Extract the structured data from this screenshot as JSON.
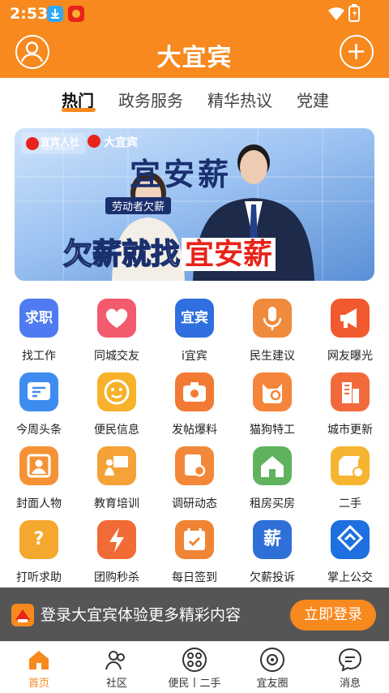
{
  "status_bar": {
    "time": "2:53"
  },
  "header": {
    "title": "大宜宾"
  },
  "tabs": [
    "热门",
    "政务服务",
    "精华热议",
    "党建"
  ],
  "banner": {
    "logo_left": "宜宾人社",
    "logo_left_sub": "YIBIN RENSHE",
    "logo_right": "大宜宾",
    "brand": "宜安薪",
    "subtitle": "劳动者欠薪",
    "headline_a": "欠薪就找",
    "headline_b": "宜安薪"
  },
  "grid": [
    {
      "label": "找工作",
      "icon": "job-icon",
      "color": "#4F7BF2",
      "text": "求职"
    },
    {
      "label": "同城交友",
      "icon": "heart-icon",
      "color": "#F25A6E",
      "text": ""
    },
    {
      "label": "i宜宾",
      "icon": "iyibin-icon",
      "color": "#2F6FE0",
      "text": "宜宾"
    },
    {
      "label": "民生建议",
      "icon": "microphone-icon",
      "color": "#F08A3C",
      "text": ""
    },
    {
      "label": "网友曝光",
      "icon": "megaphone-icon",
      "color": "#F05A2E",
      "text": ""
    },
    {
      "label": "今周头条",
      "icon": "headline-icon",
      "color": "#3E8CF0",
      "text": ""
    },
    {
      "label": "便民信息",
      "icon": "smile-icon",
      "color": "#F7B12A",
      "text": ""
    },
    {
      "label": "发帖爆料",
      "icon": "camera-icon",
      "color": "#F27A35",
      "text": ""
    },
    {
      "label": "猫狗特工",
      "icon": "cat-icon",
      "color": "#F5853A",
      "text": ""
    },
    {
      "label": "城市更新",
      "icon": "building-icon",
      "color": "#F26A3C",
      "text": ""
    },
    {
      "label": "封面人物",
      "icon": "portrait-icon",
      "color": "#F59235",
      "text": ""
    },
    {
      "label": "教育培训",
      "icon": "teacher-icon",
      "color": "#F5A238",
      "text": ""
    },
    {
      "label": "调研动态",
      "icon": "research-icon",
      "color": "#F3883A",
      "text": ""
    },
    {
      "label": "租房买房",
      "icon": "house-icon",
      "color": "#5FB35F",
      "text": ""
    },
    {
      "label": "二手",
      "icon": "box-icon",
      "color": "#F5B530",
      "text": ""
    },
    {
      "label": "打听求助",
      "icon": "question-icon",
      "color": "#F5A82E",
      "text": "?"
    },
    {
      "label": "团购秒杀",
      "icon": "lightning-icon",
      "color": "#F26A35",
      "text": ""
    },
    {
      "label": "每日签到",
      "icon": "calendar-icon",
      "color": "#F08435",
      "text": ""
    },
    {
      "label": "欠薪投诉",
      "icon": "wage-icon",
      "color": "#2F6FD8",
      "text": "薪"
    },
    {
      "label": "掌上公交",
      "icon": "bus-icon",
      "color": "#1E6FE0",
      "text": ""
    }
  ],
  "login_bar": {
    "text": "登录大宜宾体验更多精彩内容",
    "button": "立即登录"
  },
  "bottom_nav": [
    {
      "label": "首页",
      "icon": "home-icon",
      "active": true
    },
    {
      "label": "社区",
      "icon": "community-icon",
      "active": false
    },
    {
      "label": "便民丨二手",
      "icon": "services-icon",
      "active": false
    },
    {
      "label": "宜友圈",
      "icon": "circle-icon",
      "active": false
    },
    {
      "label": "消息",
      "icon": "message-icon",
      "active": false
    }
  ],
  "colors": {
    "brand": "#F7891E",
    "banner_red": "#E8231A",
    "banner_navy": "#1a2f6e"
  }
}
